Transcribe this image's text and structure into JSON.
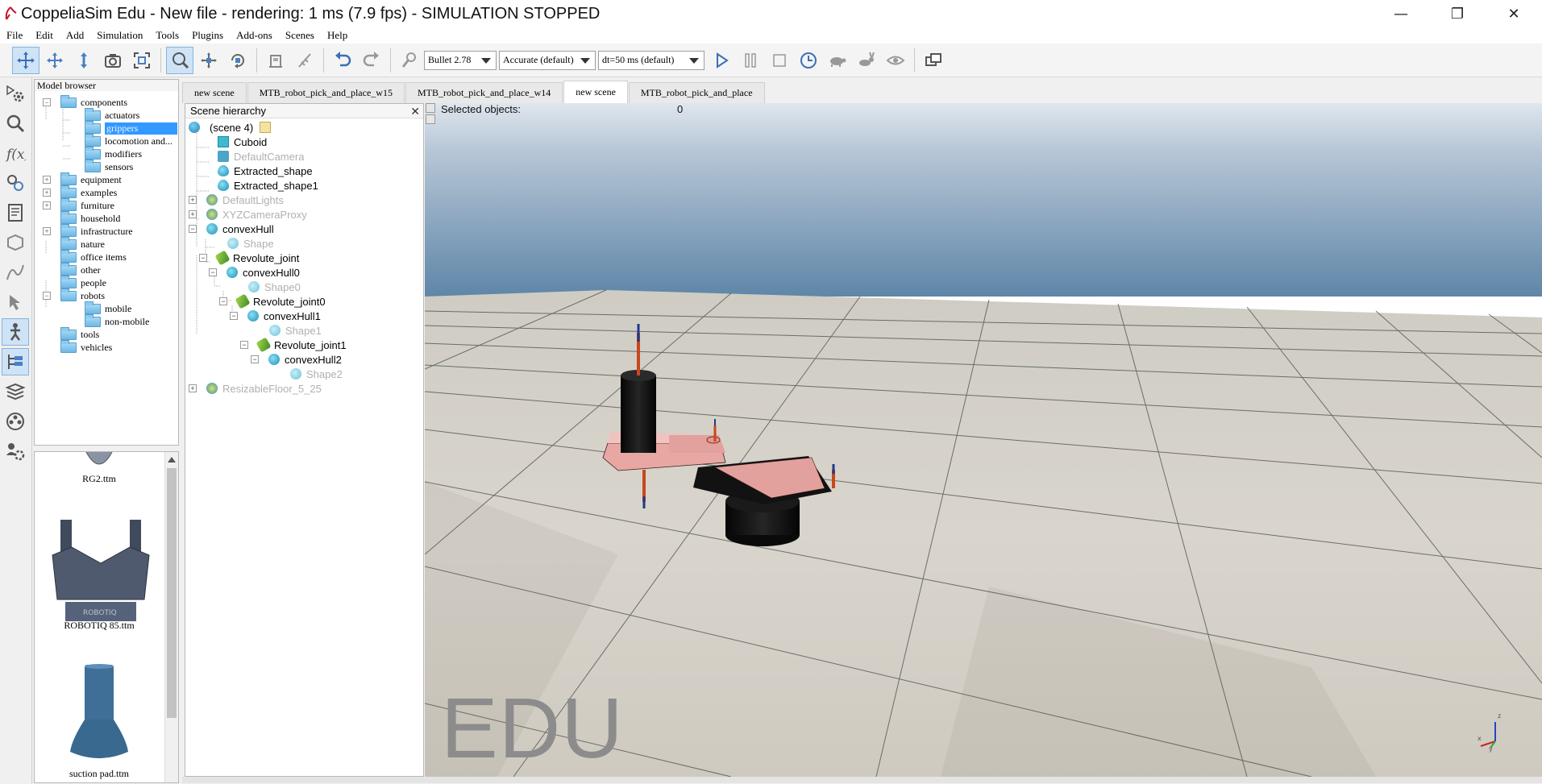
{
  "window": {
    "title": "CoppeliaSim Edu - New file - rendering: 1 ms (7.9 fps) - SIMULATION STOPPED",
    "minimize_glyph": "—",
    "maximize_glyph": "❐",
    "close_glyph": "✕"
  },
  "menu": [
    "File",
    "Edit",
    "Add",
    "Simulation",
    "Tools",
    "Plugins",
    "Add-ons",
    "Scenes",
    "Help"
  ],
  "toolbar": {
    "engine": "Bullet 2.78",
    "accuracy": "Accurate (default)",
    "dt": "dt=50 ms (default)"
  },
  "model_browser": {
    "title": "Model browser",
    "items": [
      {
        "label": "components",
        "expander": "−"
      },
      {
        "label": "actuators"
      },
      {
        "label": "grippers"
      },
      {
        "label": "locomotion and..."
      },
      {
        "label": "modifiers"
      },
      {
        "label": "sensors"
      },
      {
        "label": "equipment",
        "expander": "+"
      },
      {
        "label": "examples",
        "expander": "+"
      },
      {
        "label": "furniture",
        "expander": "+"
      },
      {
        "label": "household"
      },
      {
        "label": "infrastructure",
        "expander": "+"
      },
      {
        "label": "nature"
      },
      {
        "label": "office items"
      },
      {
        "label": "other"
      },
      {
        "label": "people"
      },
      {
        "label": "robots",
        "expander": "−"
      },
      {
        "label": "mobile"
      },
      {
        "label": "non-mobile"
      },
      {
        "label": "tools"
      },
      {
        "label": "vehicles"
      }
    ],
    "thumbnails": [
      "RG2.ttm",
      "ROBOTIQ 85.ttm",
      "suction pad.ttm"
    ],
    "robotiq_logo_text": "ROBOTIQ"
  },
  "tabs": [
    "new scene",
    "MTB_robot_pick_and_place_w15",
    "MTB_robot_pick_and_place_w14",
    "new scene",
    "MTB_robot_pick_and_place"
  ],
  "scene_hierarchy": {
    "title": "Scene hierarchy",
    "close_glyph": "✕",
    "rows": [
      {
        "label": "(scene 4)"
      },
      {
        "label": "Cuboid"
      },
      {
        "label": "DefaultCamera"
      },
      {
        "label": "Extracted_shape"
      },
      {
        "label": "Extracted_shape1"
      },
      {
        "label": "DefaultLights"
      },
      {
        "label": "XYZCameraProxy"
      },
      {
        "label": "convexHull"
      },
      {
        "label": "Shape"
      },
      {
        "label": "Revolute_joint"
      },
      {
        "label": "convexHull0"
      },
      {
        "label": "Shape0"
      },
      {
        "label": "Revolute_joint0"
      },
      {
        "label": "convexHull1"
      },
      {
        "label": "Shape1"
      },
      {
        "label": "Revolute_joint1"
      },
      {
        "label": "convexHull2"
      },
      {
        "label": "Shape2"
      },
      {
        "label": "ResizableFloor_5_25"
      }
    ]
  },
  "viewport": {
    "selected_label": "Selected objects:",
    "selected_count": "0",
    "watermark": "EDU",
    "axis_labels": {
      "x": "x",
      "y": "y",
      "z": "z"
    }
  },
  "colors": {
    "selection": "#3399ff",
    "sky_top": "#5f86a8",
    "floor": "#d8d4cc",
    "robot_link": "#e8a7a3",
    "robot_dark": "#141414"
  }
}
